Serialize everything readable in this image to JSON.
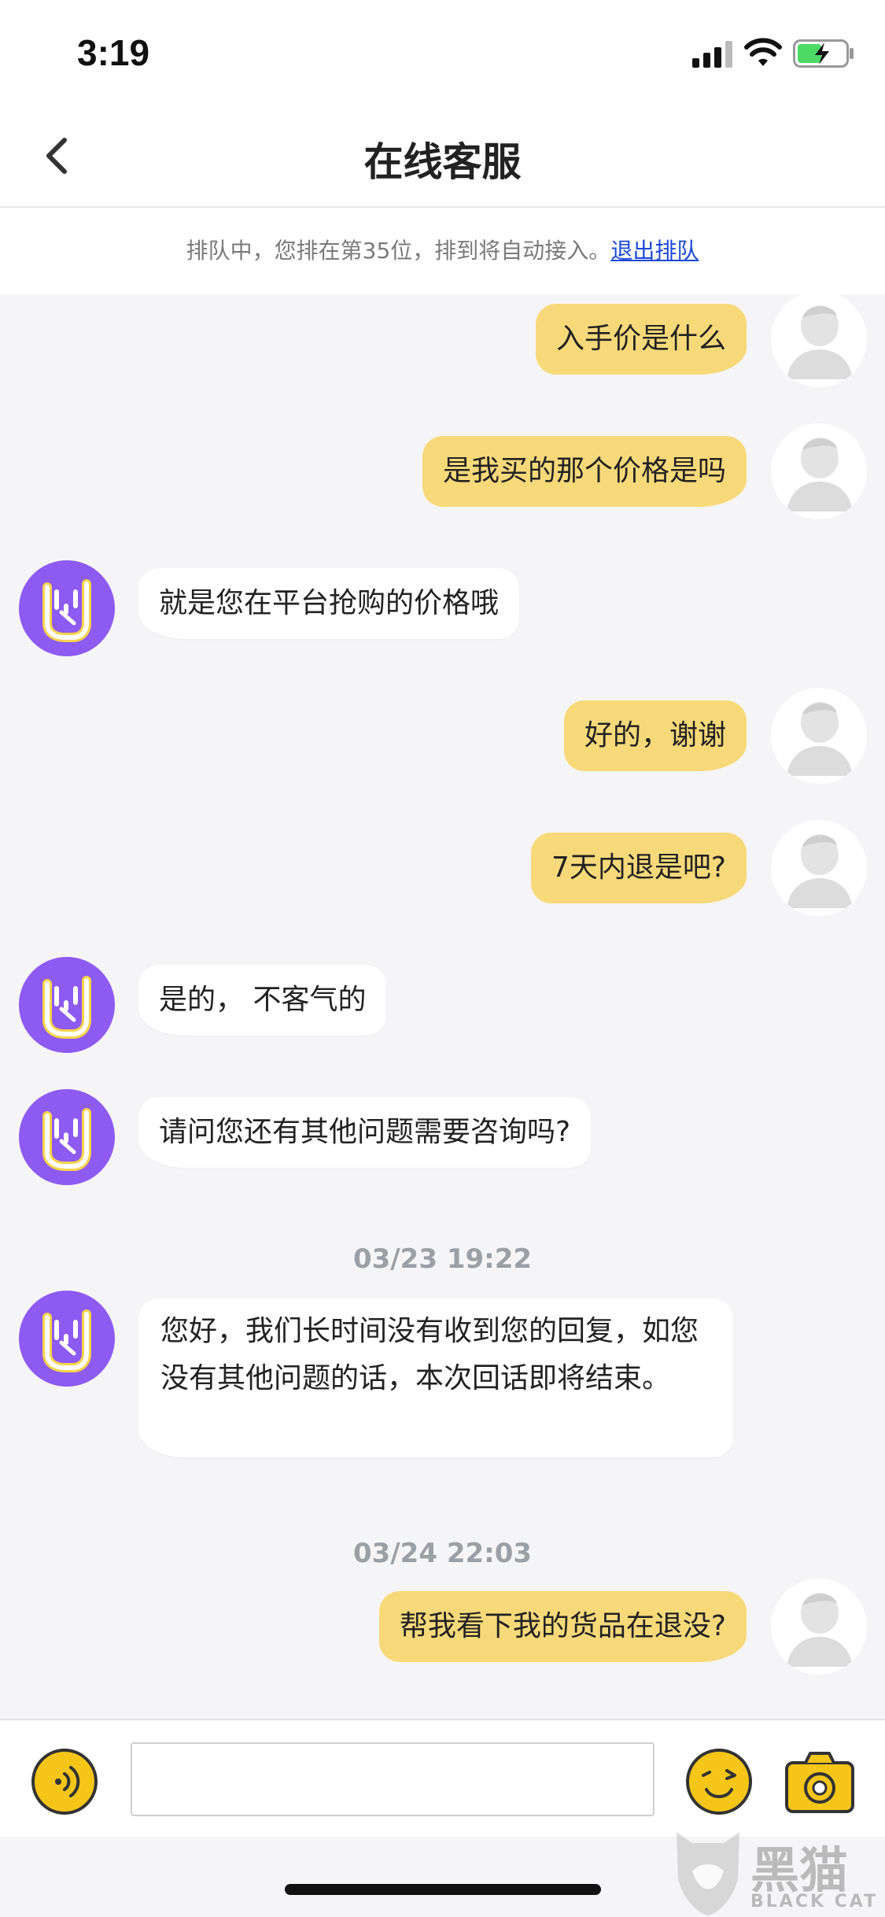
{
  "status": {
    "time": "3:19"
  },
  "nav": {
    "title": "在线客服"
  },
  "queue": {
    "text": "排队中，您排在第35位，排到将自动接入。",
    "link": "退出排队"
  },
  "messages": [
    {
      "from": "user",
      "text": "入手价是什么"
    },
    {
      "from": "user",
      "text": "是我买的那个价格是吗"
    },
    {
      "from": "agent",
      "text": "就是您在平台抢购的价格哦"
    },
    {
      "from": "user",
      "text": "好的，谢谢"
    },
    {
      "from": "user",
      "text": "7天内退是吧?"
    },
    {
      "from": "agent",
      "text": "是的， 不客气的"
    },
    {
      "from": "agent",
      "text": "请问您还有其他问题需要咨询吗?"
    },
    {
      "from": "agent",
      "text": "您好，我们长时间没有收到您的回复，如您没有其他问题的话，本次回话即将结束。"
    },
    {
      "from": "user",
      "text": "帮我看下我的货品在退没?"
    }
  ],
  "timestamps": [
    "03/23 19:22",
    "03/24 22:03"
  ],
  "input": {
    "value": "",
    "placeholder": ""
  },
  "watermark": {
    "title": "黑猫",
    "subtitle": "BLACK CAT"
  },
  "colors": {
    "user_bubble": "#f8d97a",
    "agent_avatar": "#8d5af2",
    "accent": "#f5c518",
    "link": "#1b48d8"
  },
  "icons": [
    "back-chevron-icon",
    "voice-icon",
    "emoji-icon",
    "camera-icon",
    "rock-hand-icon",
    "user-avatar-icon"
  ]
}
